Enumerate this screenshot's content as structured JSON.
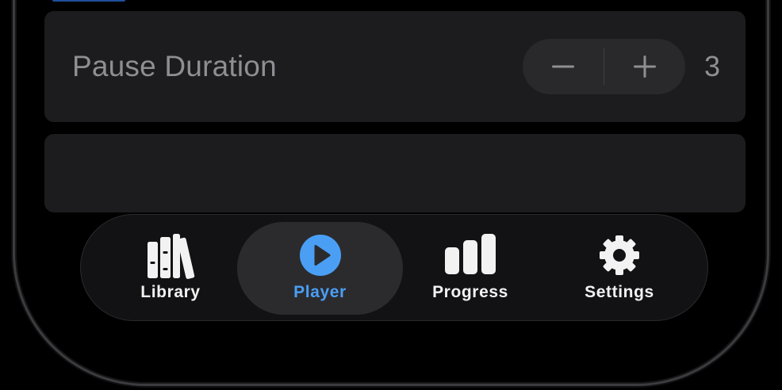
{
  "settings": {
    "pause_duration": {
      "label": "Pause Duration",
      "value": "3",
      "decrement_label": "−",
      "increment_label": "+"
    }
  },
  "tab_bar": {
    "selected": "player",
    "tabs": [
      {
        "id": "library",
        "label": "Library",
        "icon": "books-icon"
      },
      {
        "id": "player",
        "label": "Player",
        "icon": "play-circle-icon"
      },
      {
        "id": "progress",
        "label": "Progress",
        "icon": "bar-chart-icon"
      },
      {
        "id": "settings",
        "label": "Settings",
        "icon": "gear-icon"
      }
    ]
  },
  "colors": {
    "accent": "#4a9ff5",
    "card_background": "#1c1c1e",
    "tab_bar_background": "#121214",
    "selected_tab_background": "#2b2b2e",
    "secondary_text": "#8e8e93"
  }
}
